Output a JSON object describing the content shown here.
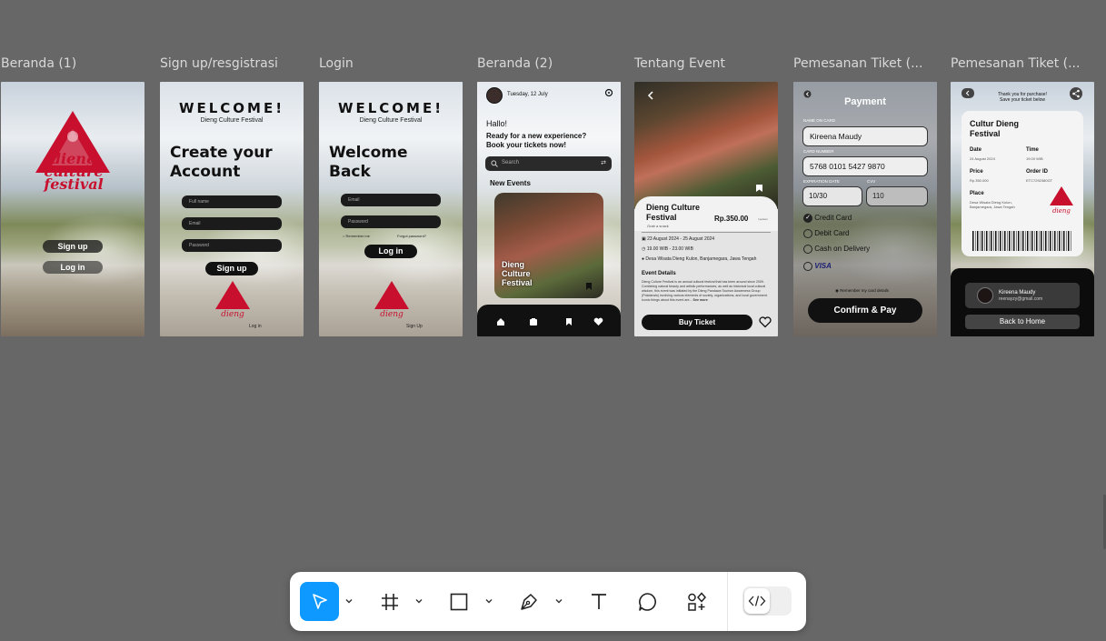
{
  "frames": {
    "beranda1": {
      "title": "Beranda (1)",
      "logo_text": "dieng culture festival",
      "signup_label": "Sign up",
      "login_label": "Log in"
    },
    "signup": {
      "title": "Sign up/resgistrasi",
      "welcome": "WELCOME!",
      "subtitle": "Dieng Culture Festival",
      "heading_line1": "Create your",
      "heading_line2": "Account",
      "fullname_placeholder": "Full name",
      "email_placeholder": "Email",
      "password_placeholder": "Password",
      "signup_label": "Sign up",
      "login_link": "Log in"
    },
    "login": {
      "title": "Login",
      "welcome": "WELCOME!",
      "subtitle": "Dieng Culture Festival",
      "heading_line1": "Welcome",
      "heading_line2": "Back",
      "email_placeholder": "Email",
      "password_placeholder": "Password",
      "remember": "Remember me",
      "forgot": "Forgot password?",
      "login_label": "Log in",
      "signup_link": "Sign Up"
    },
    "beranda2": {
      "title": "Beranda (2)",
      "date": "Tuesday, 12 July",
      "greeting": "Hallo!",
      "prompt_line1": "Ready for a new experience?",
      "prompt_line2": "Book your tickets now!",
      "search_placeholder": "Search",
      "section": "New Events",
      "card_line1": "Dieng",
      "card_line2": "Culture",
      "card_line3": "Festival"
    },
    "tentang": {
      "title": "Tentang Event",
      "event_line1": "Dieng Culture",
      "event_line2": "Festival",
      "event_sub": "Grab a snack",
      "price": "Rp.350.00",
      "price_unit": "/ person",
      "date_range": "23 August 2024 - 25 August 2024",
      "time_range": "19.00 WIB - 23.00 WIB",
      "location": "Desa Wisata Dieng Kulon, Banjarnegara, Jawa Tengah",
      "details_heading": "Event Details",
      "details_text": "Dieng Culture Festival is an annual cultural festival that has been around since 2009. Combining natural beauty and artistic performances, as well as historical local cultural wisdom, this event was initiated by the Dieng Pandawa Tourism Awareness Group (Pokdarwis) involving various elements of society, organizations, and local government. Iconic things about this event are...",
      "see_more": "See more",
      "buy_label": "Buy Ticket"
    },
    "payment": {
      "title": "Pemesanan Tiket (...",
      "heading": "Payment",
      "name_label": "NAME ON CARD",
      "name_value": "Kireena Maudy",
      "number_label": "CARD NUMBER",
      "number_value": "5768 0101 5427 9870",
      "exp_label": "EXPIRATION DATE",
      "exp_value": "10/30",
      "cvv_label": "CVV",
      "cvv_value": "110",
      "opt1": "Credit Card",
      "opt2": "Debit Card",
      "opt3": "Cash on Delivery",
      "opt4": "VISA",
      "remember": "Remember my card details",
      "confirm_label": "Confirm & Pay"
    },
    "ticket": {
      "title": "Pemesanan Tiket (...",
      "thanks_line1": "Thank you for purchase!",
      "thanks_line2": "Save your ticket below",
      "event_line1": "Cultur Dieng",
      "event_line2": "Festival",
      "date_label": "Date",
      "date_value": "24 August 2024",
      "time_label": "Time",
      "time_value": "19.00 WIB",
      "price_label": "Price",
      "price_value": "Rp.350.000",
      "order_label": "Order ID",
      "order_value": "ETC7292380GT",
      "place_label": "Place",
      "place_value": "Desa Wisata Dieng Kulon, Banjarnegara, Jawa Tengah",
      "user_name": "Kireena Maudy",
      "user_email": "reenayzy@gmail.com",
      "home_label": "Back to Home"
    }
  },
  "toolbar": {
    "tools": [
      "move-tool",
      "frame-tool",
      "rectangle-tool",
      "pen-tool",
      "text-tool",
      "comment-tool",
      "assets-tool"
    ],
    "accent": "#0d99ff"
  }
}
